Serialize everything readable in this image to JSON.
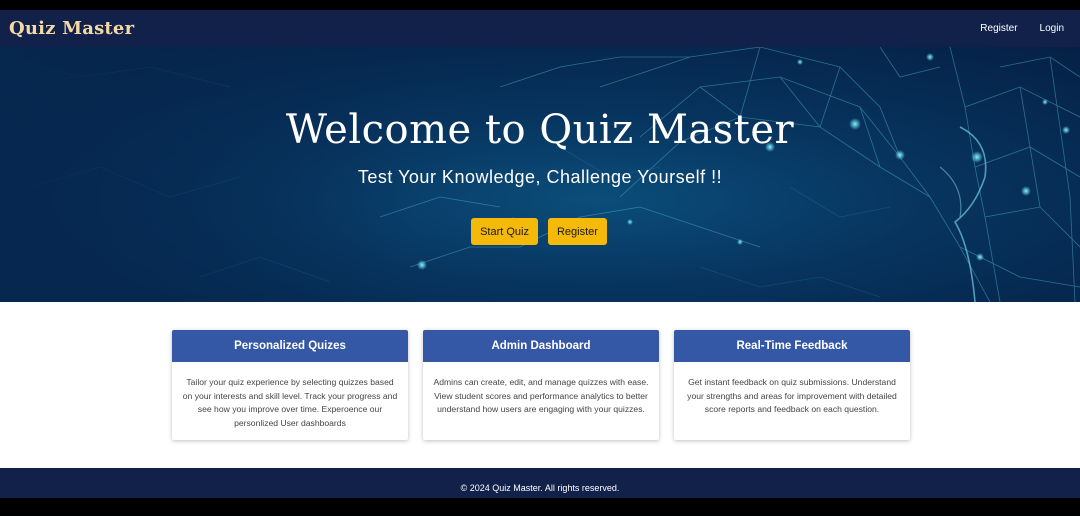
{
  "navbar": {
    "brand": "Quiz Master",
    "links": [
      "Register",
      "Login"
    ]
  },
  "hero": {
    "title": "Welcome to Quiz Master",
    "subtitle": "Test Your Knowledge, Challenge Yourself !!",
    "buttons": [
      "Start Quiz",
      "Register"
    ]
  },
  "features": [
    {
      "title": "Personalized Quizes",
      "text": "Tailor your quiz experience by selecting quizzes based on your interests and skill level. Track your progress and see how you improve over time. Experoence our personlized User dashboards"
    },
    {
      "title": "Admin Dashboard",
      "text": "Admins can create, edit, and manage quizzes with ease. View student scores and performance analytics to better understand how users are engaging with your quizzes."
    },
    {
      "title": "Real-Time Feedback",
      "text": "Get instant feedback on quiz submissions. Understand your strengths and areas for improvement with detailed score reports and feedback on each question."
    }
  ],
  "footer": {
    "text": "© 2024 Quiz Master. All rights reserved."
  },
  "colors": {
    "navbar": "#12214a",
    "brand": "#f4d9a6",
    "accent_button": "#f5b90a",
    "card_header": "#3558a6",
    "hero_background": "#07345e"
  }
}
